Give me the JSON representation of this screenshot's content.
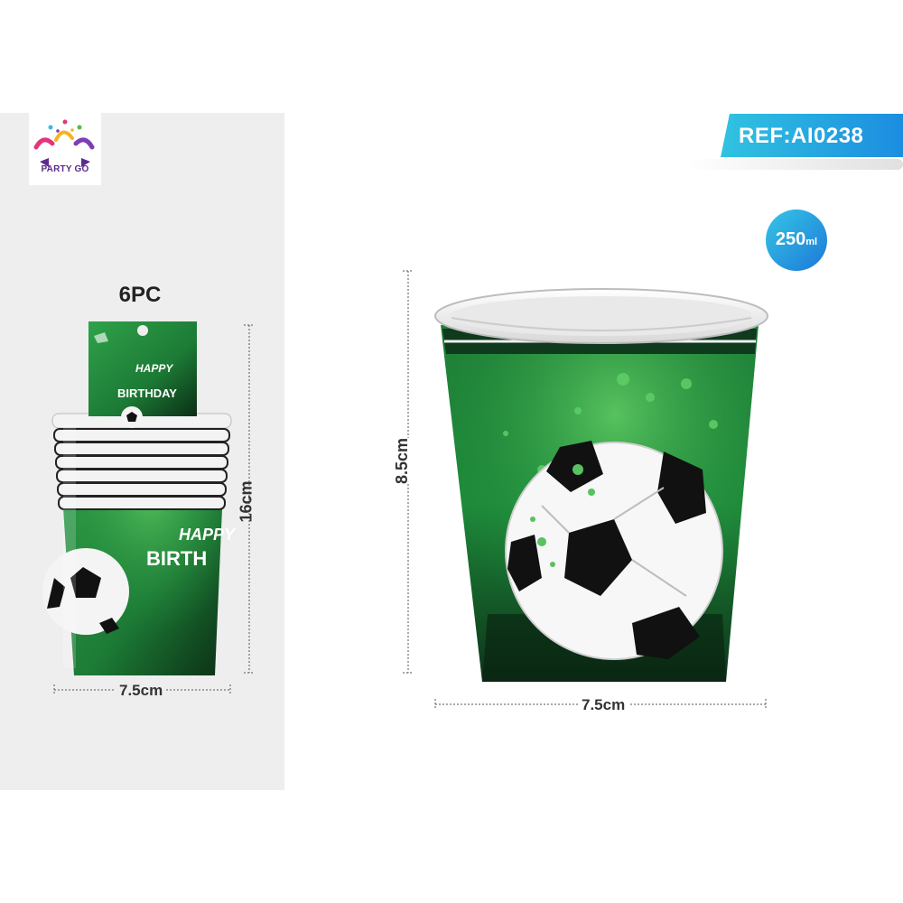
{
  "brand": {
    "logo_text": "PARTY GO"
  },
  "reference": {
    "label": "REF:AI0238"
  },
  "capacity": {
    "value": "250",
    "unit": "ml"
  },
  "pack": {
    "count_label": "6PC",
    "width_label": "7.5cm",
    "height_label": "16cm",
    "card_text": [
      "HAPPY",
      "BIRTHDAY"
    ],
    "cup_text": [
      "HAPPY",
      "BIRTH"
    ]
  },
  "cup": {
    "width_label": "7.5cm",
    "height_label": "8.5cm"
  },
  "colors": {
    "panel": "#eeeeee",
    "cup_green": "#1f8a3b",
    "cup_dark": "#0d3d1b",
    "badge_start": "#31c3e0",
    "badge_end": "#1c8de0"
  }
}
